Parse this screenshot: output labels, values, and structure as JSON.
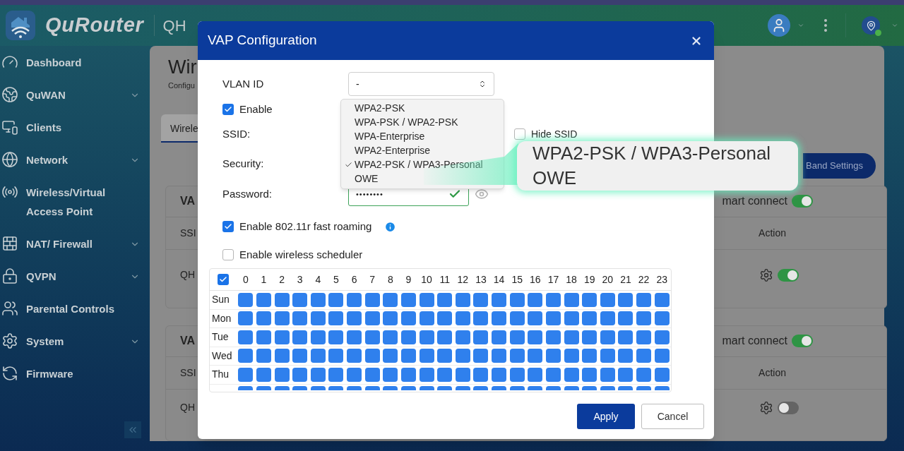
{
  "header": {
    "brand": "QuRouter",
    "device_name": "QH"
  },
  "sidebar": {
    "items": [
      {
        "label": "Dashboard",
        "submenu": false
      },
      {
        "label": "QuWAN",
        "submenu": true
      },
      {
        "label": "Clients",
        "submenu": false
      },
      {
        "label": "Network",
        "submenu": true
      },
      {
        "label": "Wireless/Virtual Access Point",
        "submenu": false
      },
      {
        "label": "NAT/ Firewall",
        "submenu": true
      },
      {
        "label": "QVPN",
        "submenu": true
      },
      {
        "label": "Parental Controls",
        "submenu": false
      },
      {
        "label": "System",
        "submenu": true
      },
      {
        "label": "Firmware",
        "submenu": false
      }
    ]
  },
  "main": {
    "title": "Wir",
    "subtitle": "Configu",
    "tabs": [
      {
        "label": "Wirele",
        "selected": true
      }
    ],
    "band_settings_button": "Band Settings",
    "cards": [
      {
        "title": "VA",
        "smart_connect_label": "mart connect",
        "smart_connect_on": true,
        "columns": [
          "SSI",
          "Action"
        ],
        "rows": [
          {
            "ssid": "QH",
            "on": true
          }
        ]
      },
      {
        "title": "VA",
        "smart_connect_label": "mart connect",
        "smart_connect_on": true,
        "columns": [
          "SSI",
          "Action"
        ],
        "rows": [
          {
            "ssid": "QH",
            "on": false
          }
        ]
      }
    ]
  },
  "modal": {
    "title": "VAP Configuration",
    "vlan_id": {
      "label": "VLAN ID",
      "value": "-"
    },
    "enable": {
      "label": "Enable",
      "checked": true
    },
    "ssid": {
      "label": "SSID:"
    },
    "hide_ssid": {
      "label": "Hide SSID",
      "checked": false
    },
    "security": {
      "label": "Security:",
      "options": [
        {
          "label": "WPA2-PSK",
          "selected": false
        },
        {
          "label": "WPA-PSK / WPA2-PSK",
          "selected": false
        },
        {
          "label": "WPA-Enterprise",
          "selected": false
        },
        {
          "label": "WPA2-Enterprise",
          "selected": false
        },
        {
          "label": "WPA2-PSK / WPA3-Personal",
          "selected": true
        },
        {
          "label": "OWE",
          "selected": false
        }
      ]
    },
    "password": {
      "label": "Password:",
      "value": "••••••••",
      "valid": true
    },
    "fast_roaming": {
      "label": "Enable 802.11r fast roaming",
      "checked": true
    },
    "scheduler": {
      "label": "Enable wireless scheduler",
      "checked": false
    },
    "schedule": {
      "all_checked": true,
      "hours": [
        "0",
        "1",
        "2",
        "3",
        "4",
        "5",
        "6",
        "7",
        "8",
        "9",
        "10",
        "11",
        "12",
        "13",
        "14",
        "15",
        "16",
        "17",
        "18",
        "19",
        "20",
        "21",
        "22",
        "23"
      ],
      "rows": [
        {
          "day": "Sun",
          "slots": [
            true,
            true,
            true,
            true,
            true,
            true,
            true,
            true,
            true,
            true,
            true,
            true,
            true,
            true,
            true,
            true,
            true,
            true,
            true,
            true,
            true,
            true,
            true,
            true
          ]
        },
        {
          "day": "Mon",
          "slots": [
            true,
            true,
            true,
            true,
            true,
            true,
            true,
            true,
            true,
            true,
            true,
            true,
            true,
            true,
            true,
            true,
            true,
            true,
            true,
            true,
            true,
            true,
            true,
            true
          ]
        },
        {
          "day": "Tue",
          "slots": [
            true,
            true,
            true,
            true,
            true,
            true,
            true,
            true,
            true,
            true,
            true,
            true,
            true,
            true,
            true,
            true,
            true,
            true,
            true,
            true,
            true,
            true,
            true,
            true
          ]
        },
        {
          "day": "Wed",
          "slots": [
            true,
            true,
            true,
            true,
            true,
            true,
            true,
            true,
            true,
            true,
            true,
            true,
            true,
            true,
            true,
            true,
            true,
            true,
            true,
            true,
            true,
            true,
            true,
            true
          ]
        },
        {
          "day": "Thu",
          "slots": [
            true,
            true,
            true,
            true,
            true,
            true,
            true,
            true,
            true,
            true,
            true,
            true,
            true,
            true,
            true,
            true,
            true,
            true,
            true,
            true,
            true,
            true,
            true,
            true
          ]
        },
        {
          "slots": [
            true,
            true,
            true,
            true,
            true,
            true,
            true,
            true,
            true,
            true,
            true,
            true,
            true,
            true,
            true,
            true,
            true,
            true,
            true,
            true,
            true,
            true,
            true,
            true
          ]
        }
      ]
    },
    "buttons": {
      "apply": "Apply",
      "cancel": "Cancel"
    }
  },
  "callout": {
    "lines": [
      "WPA2-PSK / WPA3-Personal",
      "OWE"
    ]
  }
}
